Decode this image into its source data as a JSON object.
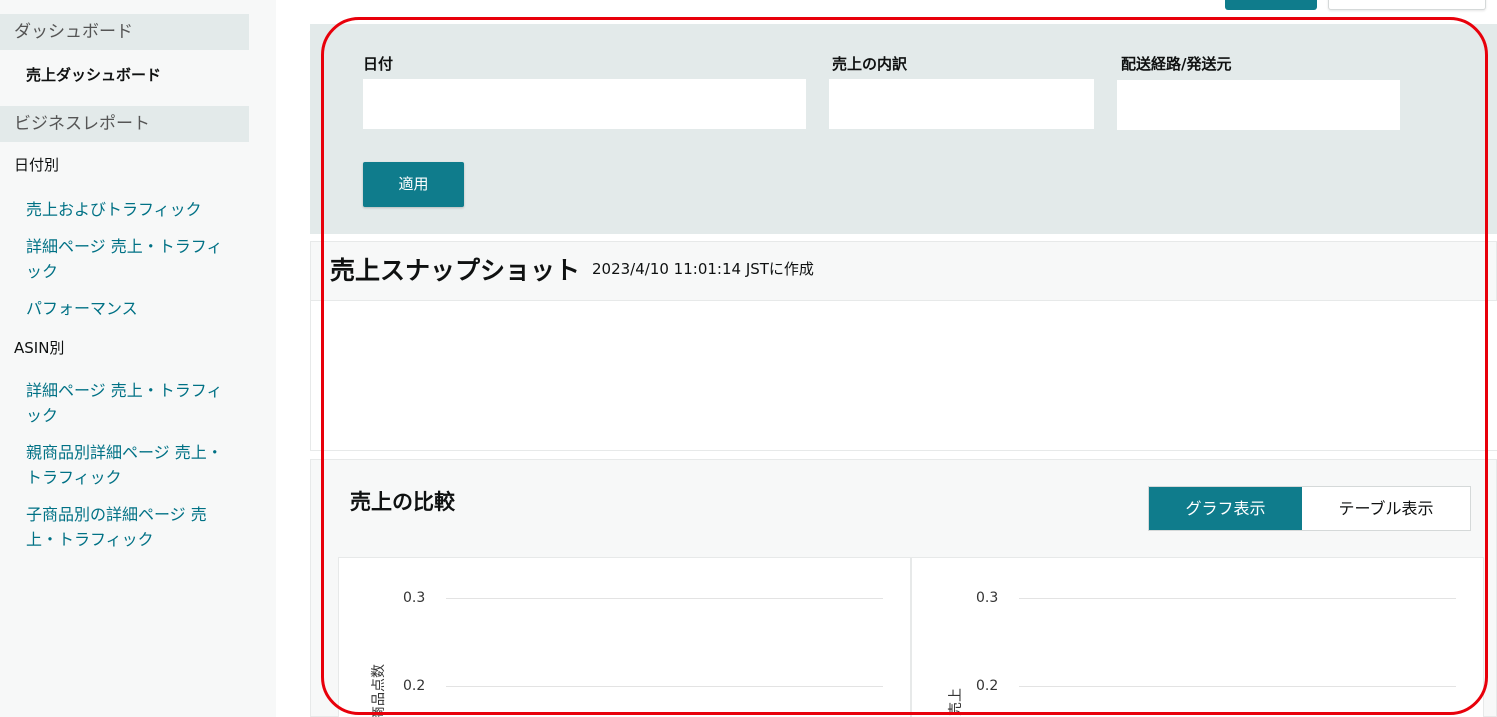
{
  "sidebar": {
    "dashboard_section": "ダッシュボード",
    "sales_dashboard": "売上ダッシュボード",
    "business_report_section": "ビジネスレポート",
    "by_date": "日付別",
    "by_date_items": [
      "売上およびトラフィック",
      "詳細ページ 売上・トラフィック",
      "パフォーマンス"
    ],
    "by_asin": "ASIN別",
    "by_asin_items": [
      "詳細ページ 売上・トラフィック",
      "親商品別詳細ページ 売上・トラフィック",
      "子商品別の詳細ページ 売上・トラフィック"
    ]
  },
  "filters": {
    "date_label": "日付",
    "breakdown_label": "売上の内訳",
    "channel_label": "配送経路/発送元",
    "date_value": "",
    "breakdown_value": "",
    "channel_value": "",
    "apply_label": "適用"
  },
  "snapshot": {
    "title": "売上スナップショット",
    "timestamp": "2023/4/10 11:01:14 JSTに作成"
  },
  "comparison": {
    "title": "売上の比較",
    "graph_view": "グラフ表示",
    "table_view": "テーブル表示"
  },
  "chart_data": [
    {
      "type": "line",
      "ylabel": "商品点数",
      "y_ticks": [
        "0.3",
        "0.2"
      ]
    },
    {
      "type": "line",
      "ylabel": "売上",
      "y_ticks": [
        "0.3",
        "0.2"
      ]
    }
  ],
  "colors": {
    "accent": "#0f7c8c",
    "link": "#007185",
    "annotation": "#e8000b"
  }
}
